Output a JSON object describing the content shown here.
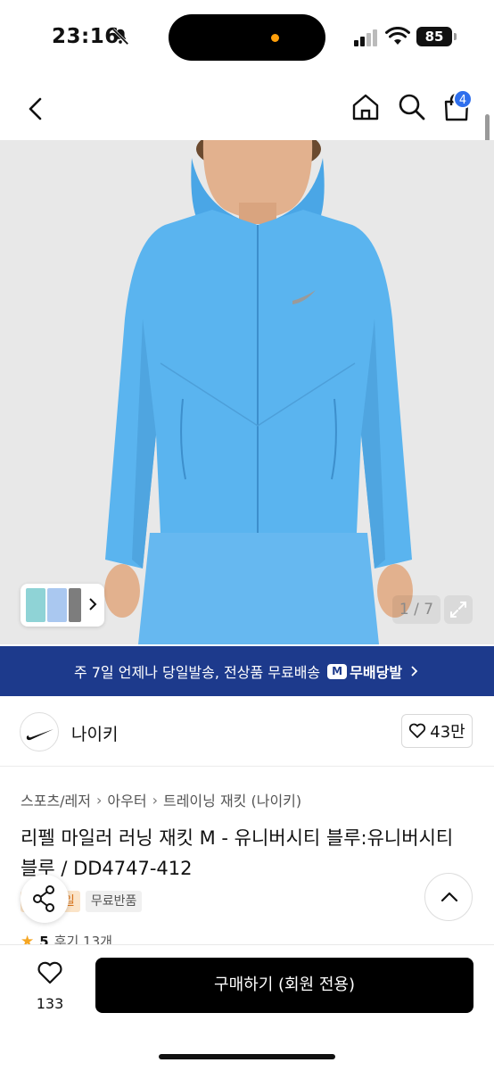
{
  "status_bar": {
    "time": "23:16",
    "battery": "85"
  },
  "nav": {
    "cart_count": "4"
  },
  "gallery": {
    "counter": "1 / 7"
  },
  "banner": {
    "text": "주 7일 언제나 당일발송, 전상품 무료배송",
    "brand_label": "무배당발",
    "brand_icon_letter": "M"
  },
  "brand": {
    "name": "나이키",
    "likes": "43만"
  },
  "breadcrumb": [
    "스포츠/레저",
    "아우터",
    "트레이닝 재킷 (나이키)"
  ],
  "product": {
    "title": "리펠 마일러 러닝 재킷 M - 유니버시티 블루:유니버시티 블루 / DD4747-412",
    "tags": [
      "일",
      "무료반품"
    ],
    "rating": "5",
    "reviews": "후기 13개"
  },
  "bottom_bar": {
    "wish_count": "133",
    "buy_label": "구매하기 (회원 전용)"
  },
  "colors": {
    "banner": "#1d3a8c",
    "jacket": "#5ab4ef",
    "badge": "#2f6fed"
  }
}
